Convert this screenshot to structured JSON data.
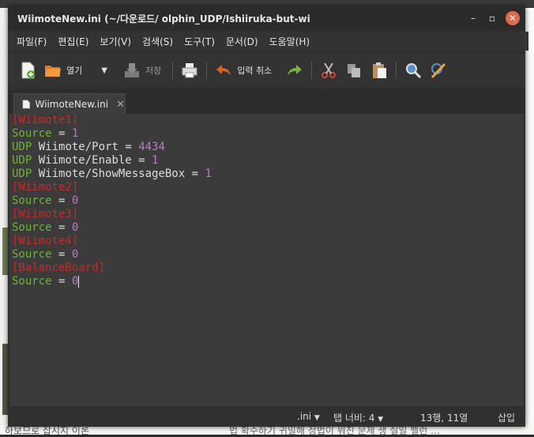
{
  "window": {
    "title": "WiimoteNew.ini (~/다운로드/   olphin_UDP/Ishiiruka-but-with-UD"
  },
  "menu": [
    "파일(F)",
    "편집(E)",
    "보기(V)",
    "검색(S)",
    "도구(T)",
    "문서(D)",
    "도움말(H)"
  ],
  "toolbar": {
    "open_label": "열기",
    "save_label": "저장",
    "undo_label": "입력 취소"
  },
  "tab": {
    "label": "WiimoteNew.ini"
  },
  "editor": {
    "lines": [
      {
        "kind": "section",
        "text": "[Wiimote1]"
      },
      {
        "kind": "kv",
        "key": "Source",
        "value": "1"
      },
      {
        "kind": "kv2",
        "k1": "UDP",
        "k2": "Wiimote/Port",
        "value": "4434"
      },
      {
        "kind": "kv2",
        "k1": "UDP",
        "k2": "Wiimote/Enable",
        "value": "1"
      },
      {
        "kind": "kv2",
        "k1": "UDP",
        "k2": "Wiimote/ShowMessageBox",
        "value": "1"
      },
      {
        "kind": "section",
        "text": "[Wiimote2]"
      },
      {
        "kind": "kv",
        "key": "Source",
        "value": "0"
      },
      {
        "kind": "section",
        "text": "[Wiimote3]"
      },
      {
        "kind": "kv",
        "key": "Source",
        "value": "0"
      },
      {
        "kind": "section",
        "text": "[Wiimote4]"
      },
      {
        "kind": "kv",
        "key": "Source",
        "value": "0"
      },
      {
        "kind": "section",
        "text": "[BalanceBoard]"
      },
      {
        "kind": "kv",
        "key": "Source",
        "value": "0"
      }
    ]
  },
  "status": {
    "filetype": ".ini",
    "tab_width": "탭 너비: 4",
    "position": "13행, 11열",
    "mode": "삽입"
  },
  "background": {
    "bottom_left": "하보므로 잡시지 이론",
    "bottom_mid": "법 확수하기 귀밀해 정법이 뭐진 문제 생 질일 펠런 …"
  },
  "colors": {
    "section": "#c42a2a",
    "key": "#6bb82e",
    "number": "#b57cc2",
    "close_button": "#e06a4a"
  }
}
